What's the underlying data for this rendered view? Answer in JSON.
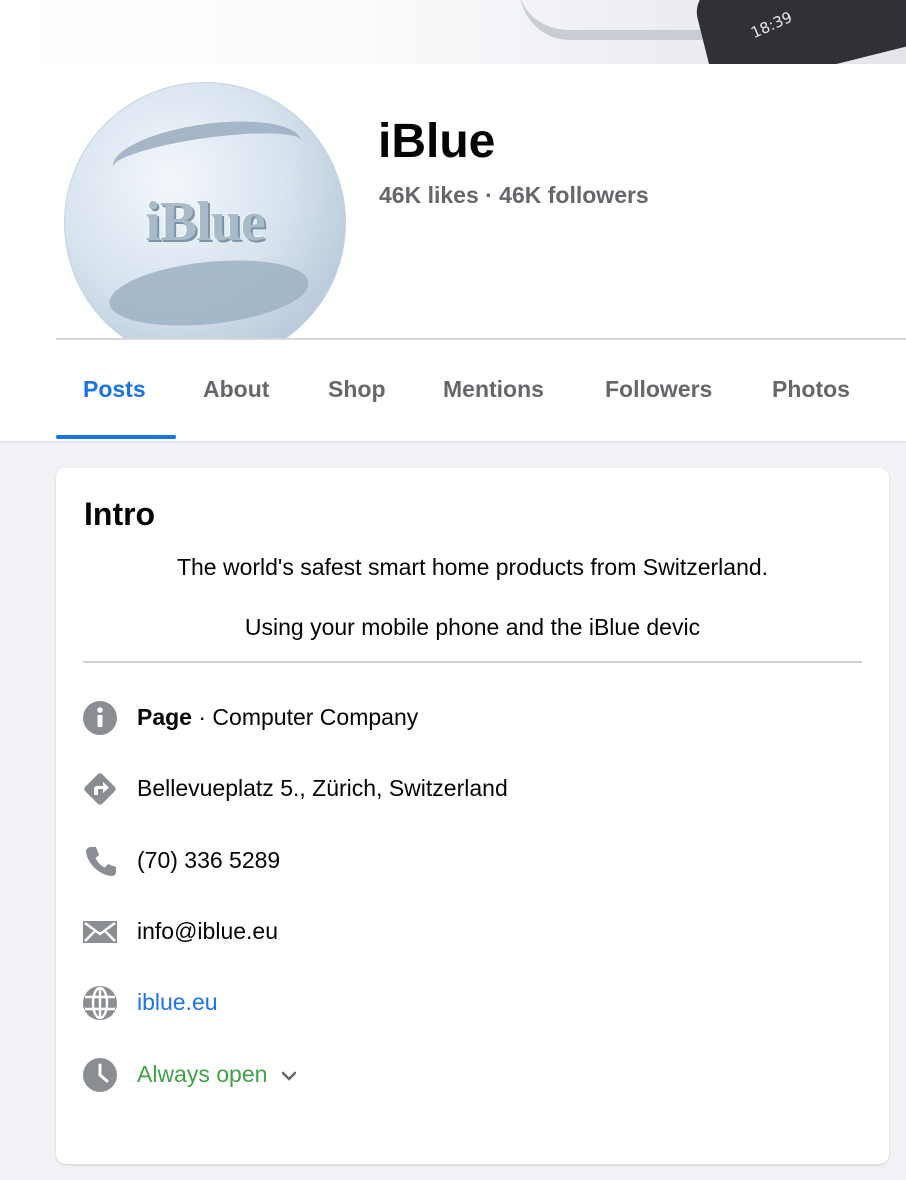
{
  "cover": {
    "device_time": "18:39"
  },
  "page": {
    "name": "iBlue",
    "avatar_text": "iBlue",
    "stats": "46K likes · 46K followers"
  },
  "tabs": [
    {
      "label": "Posts",
      "active": true
    },
    {
      "label": "About"
    },
    {
      "label": "Shop"
    },
    {
      "label": "Mentions"
    },
    {
      "label": "Followers"
    },
    {
      "label": "Photos"
    }
  ],
  "intro": {
    "title": "Intro",
    "bio_line_1": "The world's safest smart home products from Switzerland.",
    "bio_line_2": "Using your mobile phone and the iBlue devic",
    "category_label": "Page",
    "category_value": " · Computer Company",
    "address": "Bellevueplatz 5., Zürich, Switzerland",
    "phone": "(70) 336 5289",
    "email": "info@iblue.eu",
    "website": "iblue.eu",
    "hours": "Always open"
  },
  "colors": {
    "accent": "#1b74e4",
    "open_green": "#42a148",
    "icon_gray": "#8a8d91",
    "secondary_text": "#65676b"
  },
  "icons": [
    "info-icon",
    "directions-icon",
    "phone-icon",
    "mail-icon",
    "globe-icon",
    "clock-icon",
    "chevron-down-icon"
  ]
}
